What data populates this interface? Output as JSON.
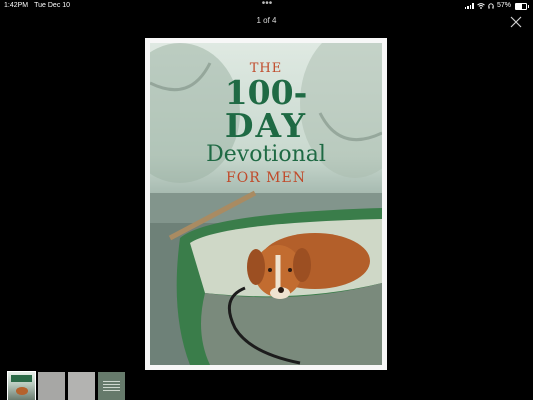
{
  "status_bar": {
    "time": "1:42PM",
    "date": "Tue Dec 10",
    "battery_percent": "57%",
    "battery_level": 0.57,
    "icons": [
      "signal-icon",
      "wifi-icon",
      "headphones-icon",
      "battery-icon"
    ]
  },
  "viewer": {
    "page_indicator": "1 of 4",
    "more_icon": "more-dots-icon",
    "close_icon": "close-icon"
  },
  "cover": {
    "line1": "THE",
    "line2": "100-",
    "line3": "DAY",
    "line4": "Devotional",
    "line5": "FOR MEN"
  },
  "thumbnails": [
    {
      "index": 1,
      "selected": true
    },
    {
      "index": 2,
      "selected": false
    },
    {
      "index": 3,
      "selected": false
    },
    {
      "index": 4,
      "selected": false
    }
  ],
  "colors": {
    "background": "#000000",
    "title_green": "#1f6a44",
    "title_red": "#c04a2a"
  }
}
